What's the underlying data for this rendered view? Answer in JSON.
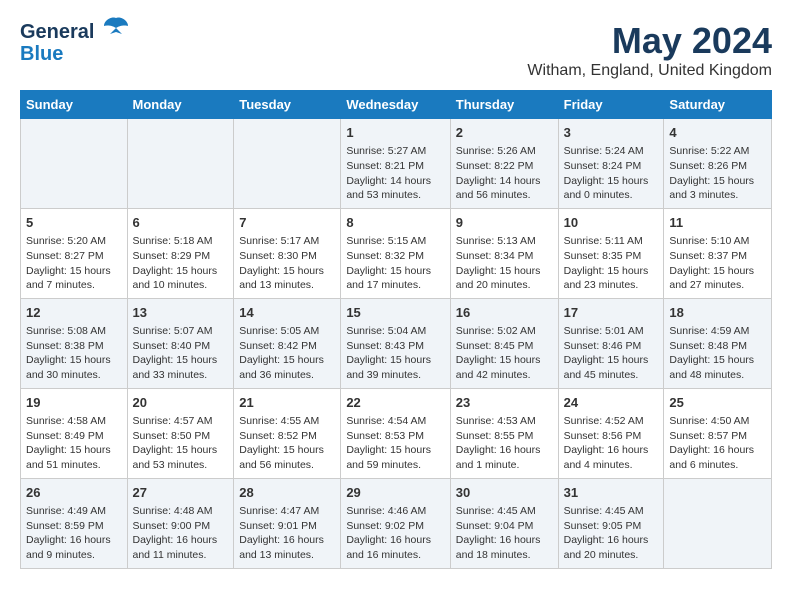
{
  "header": {
    "logo_line1": "General",
    "logo_line2": "Blue",
    "month_title": "May 2024",
    "location": "Witham, England, United Kingdom"
  },
  "weekdays": [
    "Sunday",
    "Monday",
    "Tuesday",
    "Wednesday",
    "Thursday",
    "Friday",
    "Saturday"
  ],
  "weeks": [
    [
      {
        "day": "",
        "info": ""
      },
      {
        "day": "",
        "info": ""
      },
      {
        "day": "",
        "info": ""
      },
      {
        "day": "1",
        "info": "Sunrise: 5:27 AM\nSunset: 8:21 PM\nDaylight: 14 hours and 53 minutes."
      },
      {
        "day": "2",
        "info": "Sunrise: 5:26 AM\nSunset: 8:22 PM\nDaylight: 14 hours and 56 minutes."
      },
      {
        "day": "3",
        "info": "Sunrise: 5:24 AM\nSunset: 8:24 PM\nDaylight: 15 hours and 0 minutes."
      },
      {
        "day": "4",
        "info": "Sunrise: 5:22 AM\nSunset: 8:26 PM\nDaylight: 15 hours and 3 minutes."
      }
    ],
    [
      {
        "day": "5",
        "info": "Sunrise: 5:20 AM\nSunset: 8:27 PM\nDaylight: 15 hours and 7 minutes."
      },
      {
        "day": "6",
        "info": "Sunrise: 5:18 AM\nSunset: 8:29 PM\nDaylight: 15 hours and 10 minutes."
      },
      {
        "day": "7",
        "info": "Sunrise: 5:17 AM\nSunset: 8:30 PM\nDaylight: 15 hours and 13 minutes."
      },
      {
        "day": "8",
        "info": "Sunrise: 5:15 AM\nSunset: 8:32 PM\nDaylight: 15 hours and 17 minutes."
      },
      {
        "day": "9",
        "info": "Sunrise: 5:13 AM\nSunset: 8:34 PM\nDaylight: 15 hours and 20 minutes."
      },
      {
        "day": "10",
        "info": "Sunrise: 5:11 AM\nSunset: 8:35 PM\nDaylight: 15 hours and 23 minutes."
      },
      {
        "day": "11",
        "info": "Sunrise: 5:10 AM\nSunset: 8:37 PM\nDaylight: 15 hours and 27 minutes."
      }
    ],
    [
      {
        "day": "12",
        "info": "Sunrise: 5:08 AM\nSunset: 8:38 PM\nDaylight: 15 hours and 30 minutes."
      },
      {
        "day": "13",
        "info": "Sunrise: 5:07 AM\nSunset: 8:40 PM\nDaylight: 15 hours and 33 minutes."
      },
      {
        "day": "14",
        "info": "Sunrise: 5:05 AM\nSunset: 8:42 PM\nDaylight: 15 hours and 36 minutes."
      },
      {
        "day": "15",
        "info": "Sunrise: 5:04 AM\nSunset: 8:43 PM\nDaylight: 15 hours and 39 minutes."
      },
      {
        "day": "16",
        "info": "Sunrise: 5:02 AM\nSunset: 8:45 PM\nDaylight: 15 hours and 42 minutes."
      },
      {
        "day": "17",
        "info": "Sunrise: 5:01 AM\nSunset: 8:46 PM\nDaylight: 15 hours and 45 minutes."
      },
      {
        "day": "18",
        "info": "Sunrise: 4:59 AM\nSunset: 8:48 PM\nDaylight: 15 hours and 48 minutes."
      }
    ],
    [
      {
        "day": "19",
        "info": "Sunrise: 4:58 AM\nSunset: 8:49 PM\nDaylight: 15 hours and 51 minutes."
      },
      {
        "day": "20",
        "info": "Sunrise: 4:57 AM\nSunset: 8:50 PM\nDaylight: 15 hours and 53 minutes."
      },
      {
        "day": "21",
        "info": "Sunrise: 4:55 AM\nSunset: 8:52 PM\nDaylight: 15 hours and 56 minutes."
      },
      {
        "day": "22",
        "info": "Sunrise: 4:54 AM\nSunset: 8:53 PM\nDaylight: 15 hours and 59 minutes."
      },
      {
        "day": "23",
        "info": "Sunrise: 4:53 AM\nSunset: 8:55 PM\nDaylight: 16 hours and 1 minute."
      },
      {
        "day": "24",
        "info": "Sunrise: 4:52 AM\nSunset: 8:56 PM\nDaylight: 16 hours and 4 minutes."
      },
      {
        "day": "25",
        "info": "Sunrise: 4:50 AM\nSunset: 8:57 PM\nDaylight: 16 hours and 6 minutes."
      }
    ],
    [
      {
        "day": "26",
        "info": "Sunrise: 4:49 AM\nSunset: 8:59 PM\nDaylight: 16 hours and 9 minutes."
      },
      {
        "day": "27",
        "info": "Sunrise: 4:48 AM\nSunset: 9:00 PM\nDaylight: 16 hours and 11 minutes."
      },
      {
        "day": "28",
        "info": "Sunrise: 4:47 AM\nSunset: 9:01 PM\nDaylight: 16 hours and 13 minutes."
      },
      {
        "day": "29",
        "info": "Sunrise: 4:46 AM\nSunset: 9:02 PM\nDaylight: 16 hours and 16 minutes."
      },
      {
        "day": "30",
        "info": "Sunrise: 4:45 AM\nSunset: 9:04 PM\nDaylight: 16 hours and 18 minutes."
      },
      {
        "day": "31",
        "info": "Sunrise: 4:45 AM\nSunset: 9:05 PM\nDaylight: 16 hours and 20 minutes."
      },
      {
        "day": "",
        "info": ""
      }
    ]
  ]
}
